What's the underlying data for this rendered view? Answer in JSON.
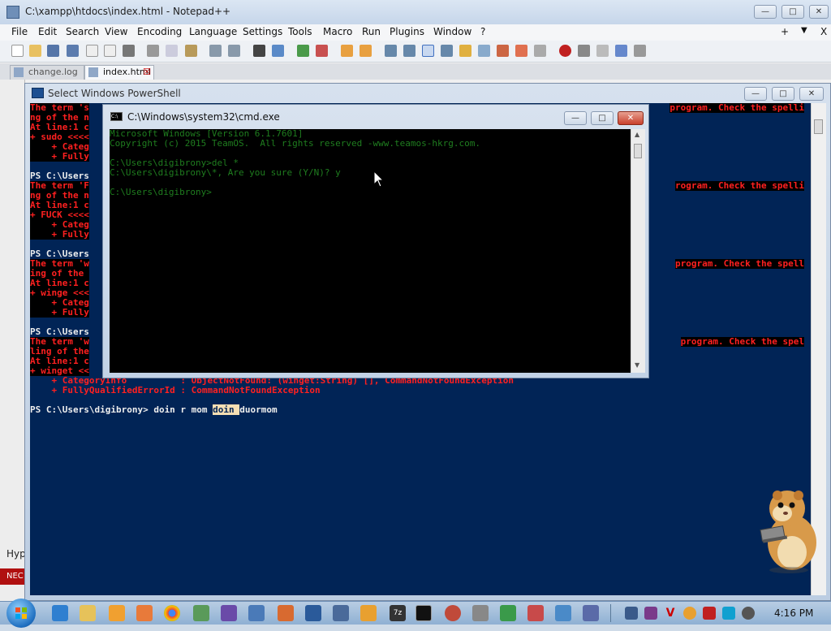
{
  "notepad": {
    "title": "C:\\xampp\\htdocs\\index.html - Notepad++",
    "menu": [
      "File",
      "Edit",
      "Search",
      "View",
      "Encoding",
      "Language",
      "Settings",
      "Tools",
      "Macro",
      "Run",
      "Plugins",
      "Window",
      "?"
    ],
    "menu_right": {
      "plus": "+",
      "arrow": "▼",
      "close": "X"
    },
    "tabs": [
      {
        "label": "change.log"
      },
      {
        "label": "index.html"
      }
    ],
    "left_text": "Hyp",
    "left_badge": "NEC"
  },
  "powershell": {
    "title": "Select Windows PowerShell",
    "lines": [
      {
        "t": "The term 's",
        "c": "red",
        "right": "program. Check the spelli"
      },
      {
        "t": "ng of the n",
        "c": "red"
      },
      {
        "t": "At line:1 c",
        "c": "red"
      },
      {
        "t": "+ sudo <<<<",
        "c": "red"
      },
      {
        "t": "    + Categ",
        "c": "red"
      },
      {
        "t": "    + Fully",
        "c": "red"
      },
      {
        "t": "",
        "c": "red"
      },
      {
        "t": "PS C:\\Users",
        "c": "white"
      },
      {
        "t": "The term 'F",
        "c": "red",
        "right": "rogram. Check the spelli"
      },
      {
        "t": "ng of the n",
        "c": "red"
      },
      {
        "t": "At line:1 c",
        "c": "red"
      },
      {
        "t": "+ FUCK <<<<",
        "c": "red"
      },
      {
        "t": "    + Categ",
        "c": "red"
      },
      {
        "t": "    + Fully",
        "c": "red"
      },
      {
        "t": "",
        "c": "red"
      },
      {
        "t": "PS C:\\Users",
        "c": "white"
      },
      {
        "t": "The term 'w",
        "c": "red",
        "right": "program. Check the spell"
      },
      {
        "t": "ing of the ",
        "c": "red"
      },
      {
        "t": "At line:1 c",
        "c": "red"
      },
      {
        "t": "+ winge <<<",
        "c": "red"
      },
      {
        "t": "    + Categ",
        "c": "red"
      },
      {
        "t": "    + Fully",
        "c": "red"
      },
      {
        "t": "",
        "c": "red"
      },
      {
        "t": "PS C:\\Users",
        "c": "white"
      },
      {
        "t": "The term 'w",
        "c": "red",
        "right": "program. Check the spel"
      },
      {
        "t": "ling of the",
        "c": "red"
      },
      {
        "t": "At line:1 c",
        "c": "red"
      },
      {
        "t": "+ winget <<",
        "c": "red"
      },
      {
        "t": "    + CategoryInfo          : ObjectNotFound: (winget:String) [], CommandNotFoundException",
        "c": "red"
      },
      {
        "t": "    + FullyQualifiedErrorId : CommandNotFoundException",
        "c": "red"
      },
      {
        "t": "",
        "c": "red"
      }
    ],
    "prompt": "PS C:\\Users\\digibrony> doin r mom ",
    "prompt_selected": "doin ",
    "prompt_rest": "duormom"
  },
  "cmd": {
    "title": "C:\\Windows\\system32\\cmd.exe",
    "icon_label": "C:\\",
    "lines": [
      "Microsoft Windows [Version 6.1.7601]",
      "Copyright (c) 2015 TeamOS.  All rights reserved -www.teamos-hkrg.com.",
      "",
      "C:\\Users\\digibrony>del *",
      "C:\\Users\\digibrony\\*, Are you sure (Y/N)? y",
      "",
      "C:\\Users\\digibrony>"
    ]
  },
  "taskbar": {
    "clock": "4:16 PM"
  }
}
